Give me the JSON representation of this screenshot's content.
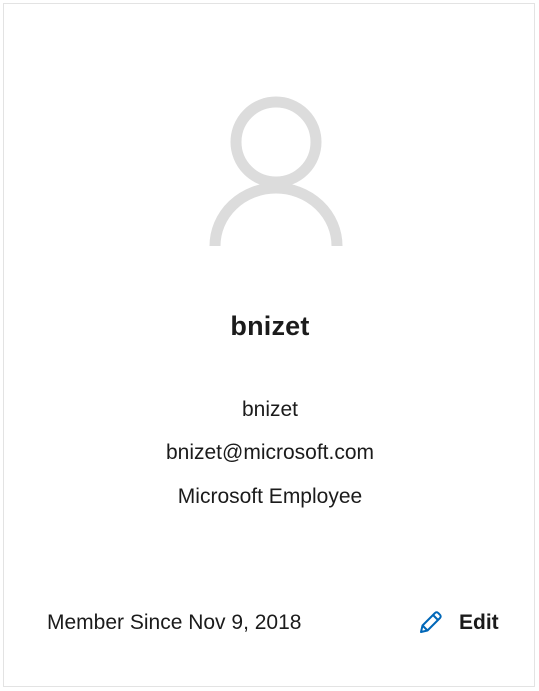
{
  "profile": {
    "display_name": "bnizet",
    "username": "bnizet",
    "email": "bnizet@microsoft.com",
    "role": "Microsoft Employee",
    "member_since": "Member Since Nov 9, 2018",
    "edit_label": "Edit"
  },
  "icons": {
    "avatar": "person-silhouette-icon",
    "edit": "pencil-icon"
  },
  "colors": {
    "avatar_gray": "#dcdcdc",
    "accent_blue": "#0067b8",
    "text": "#1b1b1b",
    "border": "#e3e3e3"
  }
}
